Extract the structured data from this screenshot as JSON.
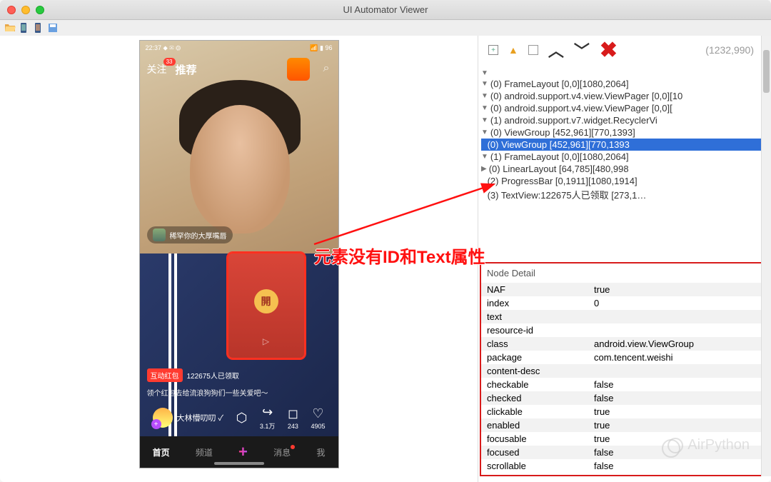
{
  "window": {
    "title": "UI Automator Viewer"
  },
  "phone": {
    "status": {
      "time": "22:37 ⬥ ✉ ⚙",
      "battery": "📶 ▮ 96"
    },
    "tabs": {
      "follow": "关注",
      "follow_badge": "33",
      "recommend": "推荐"
    },
    "pill_text": "稀罕你的大厚嘴唇",
    "redpacket": {
      "seal": "開"
    },
    "caption": {
      "tag": "互动红包",
      "count": "122675人已领取",
      "sub": "领个红包去给流浪狗狗们一些关爱吧～"
    },
    "user": {
      "name": "大林懵叨叨 ✓"
    },
    "actions": {
      "share": "3.1万",
      "comment": "243",
      "like": "4905"
    },
    "nav": [
      "首页",
      "频道",
      "消息",
      "我"
    ]
  },
  "inspector": {
    "coords": "(1232,990)"
  },
  "tree": [
    "(0) FrameLayout [0,0][1080,2064]",
    "(0) android.support.v4.view.ViewPager [0,0][10",
    "(0) android.support.v4.view.ViewPager [0,0][",
    "(1) android.support.v7.widget.RecyclerVi",
    "(0) ViewGroup [452,961][770,1393]",
    "(0) ViewGroup [452,961][770,1393",
    "(1) FrameLayout [0,0][1080,2064]",
    "(0) LinearLayout [64,785][480,998",
    "(2) ProgressBar [0,1911][1080,1914]",
    "(3) TextView:122675人已领取 [273,1…"
  ],
  "detail": {
    "header": "Node Detail",
    "rows": [
      {
        "k": "NAF",
        "v": "true"
      },
      {
        "k": "index",
        "v": "0"
      },
      {
        "k": "text",
        "v": ""
      },
      {
        "k": "resource-id",
        "v": ""
      },
      {
        "k": "class",
        "v": "android.view.ViewGroup"
      },
      {
        "k": "package",
        "v": "com.tencent.weishi"
      },
      {
        "k": "content-desc",
        "v": ""
      },
      {
        "k": "checkable",
        "v": "false"
      },
      {
        "k": "checked",
        "v": "false"
      },
      {
        "k": "clickable",
        "v": "true"
      },
      {
        "k": "enabled",
        "v": "true"
      },
      {
        "k": "focusable",
        "v": "true"
      },
      {
        "k": "focused",
        "v": "false"
      },
      {
        "k": "scrollable",
        "v": "false"
      }
    ]
  },
  "annotation": "元素没有ID和Text属性",
  "watermark": "AirPython"
}
